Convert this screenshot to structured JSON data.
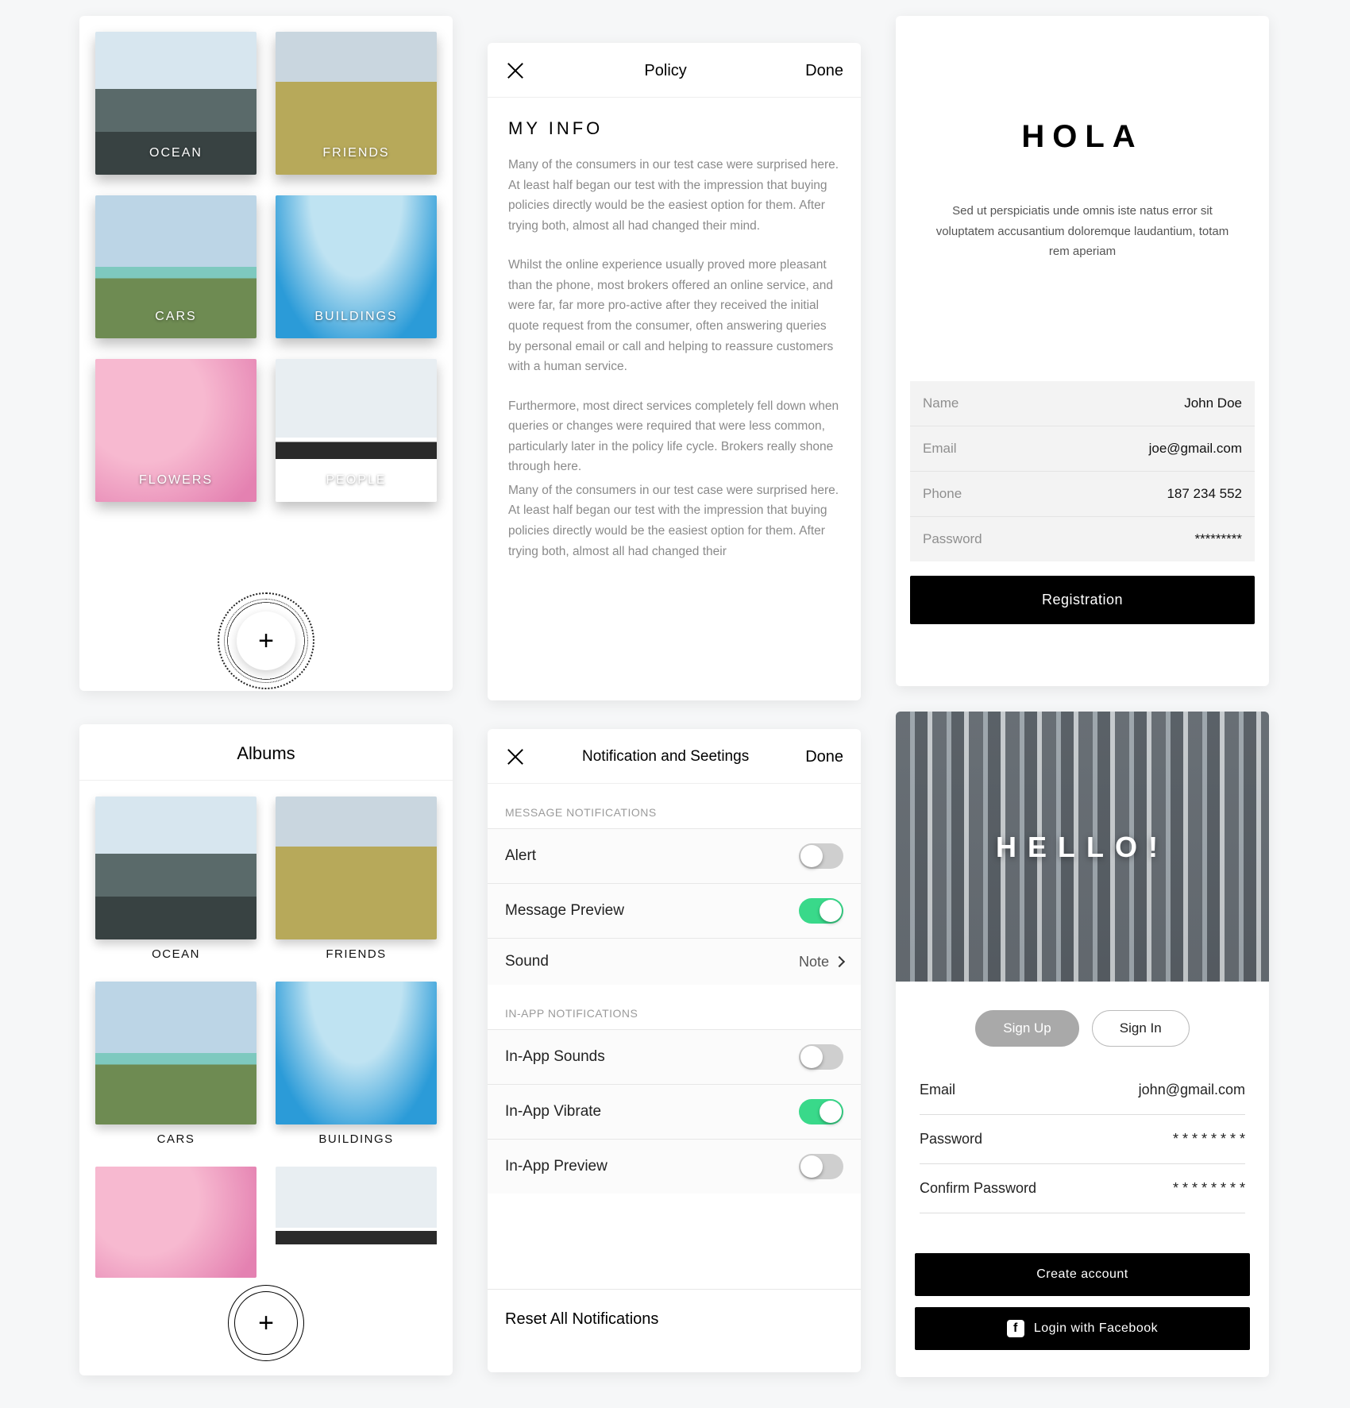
{
  "albums_overlay": {
    "items": [
      {
        "label": "OCEAN"
      },
      {
        "label": "FRIENDS"
      },
      {
        "label": "CARS"
      },
      {
        "label": "BUILDINGS"
      },
      {
        "label": "FLOWERS"
      },
      {
        "label": "PEOPLE"
      }
    ]
  },
  "albums_page": {
    "title": "Albums",
    "items": [
      {
        "label": "OCEAN"
      },
      {
        "label": "FRIENDS"
      },
      {
        "label": "CARS"
      },
      {
        "label": "BUILDINGS"
      }
    ]
  },
  "policy": {
    "nav_title": "Policy",
    "done": "Done",
    "heading": "MY INFO",
    "paragraphs": [
      "Many of the consumers in our test case were surprised here. At least half began our test with the impression that buying policies directly would be the easiest option for them. After trying both, almost all had changed their mind.",
      "Whilst the online experience usually proved more pleasant than the phone, most brokers offered an online service, and were far, far more pro-active after they received the initial quote request from the consumer, often answering queries by personal email or call and helping to reassure customers with a human service.",
      "Furthermore, most direct services completely fell down when queries or changes were required that were less common, particularly later in the policy life cycle. Brokers really shone through here.",
      "Many of the consumers in our test case were surprised here. At least half began our test with the impression that buying policies directly would be the easiest option for them. After trying both, almost all had changed their"
    ]
  },
  "settings": {
    "nav_title": "Notification and Seetings",
    "done": "Done",
    "section1": "MESSAGE NOTIFICATIONS",
    "rows1": [
      {
        "label": "Alert",
        "on": false
      },
      {
        "label": "Message Preview",
        "on": true
      },
      {
        "label": "Sound",
        "value": "Note"
      }
    ],
    "section2": "IN-APP NOTIFICATIONS",
    "rows2": [
      {
        "label": "In-App Sounds",
        "on": false
      },
      {
        "label": "In-App Vibrate",
        "on": true
      },
      {
        "label": "In-App Preview",
        "on": false
      }
    ],
    "reset": "Reset All Notifications"
  },
  "registration": {
    "brand": "HOLA",
    "subtitle": "Sed ut perspiciatis unde omnis iste natus error sit voluptatem accusantium doloremque laudantium, totam rem aperiam",
    "fields": [
      {
        "label": "Name",
        "value": "John Doe"
      },
      {
        "label": "Email",
        "value": "joe@gmail.com"
      },
      {
        "label": "Phone",
        "value": "187 234  552"
      },
      {
        "label": "Password",
        "value": "*********"
      }
    ],
    "button": "Registration"
  },
  "signup": {
    "hero_text": "HELLO!",
    "tabs": {
      "signup": "Sign Up",
      "signin": "Sign In"
    },
    "fields": [
      {
        "label": "Email",
        "value": "john@gmail.com"
      },
      {
        "label": "Password",
        "value": "* * * * * * * *"
      },
      {
        "label": "Confirm Password",
        "value": "* * * * * * * *"
      }
    ],
    "create_btn": "Create account",
    "fb_btn": "Login with Facebook"
  }
}
